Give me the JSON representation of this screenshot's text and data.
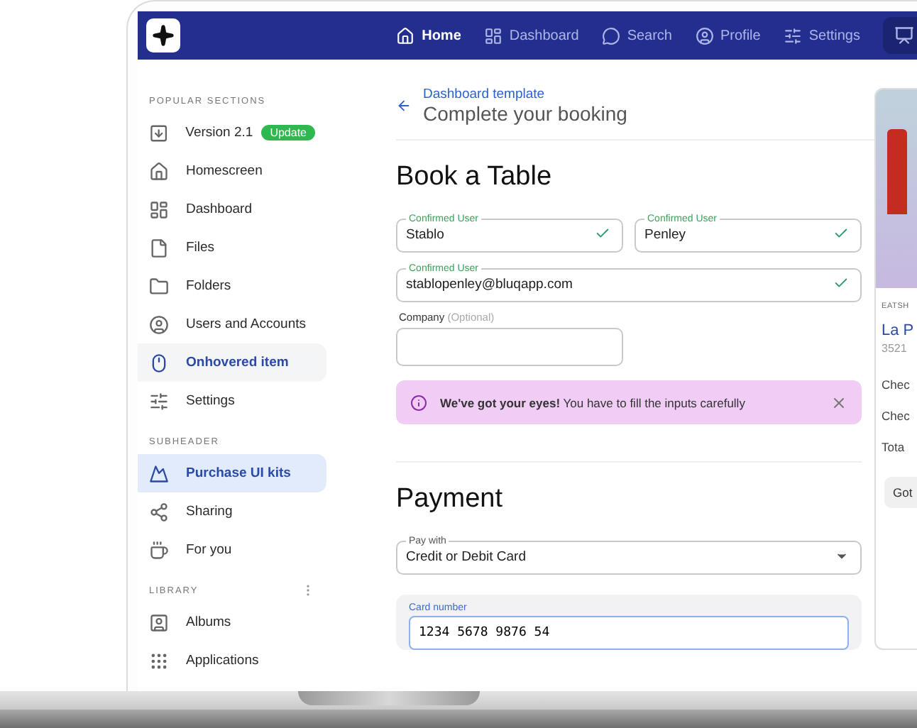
{
  "nav": {
    "items": [
      {
        "label": "Home",
        "selected": true
      },
      {
        "label": "Dashboard",
        "selected": false
      },
      {
        "label": "Search",
        "selected": false
      },
      {
        "label": "Profile",
        "selected": false
      },
      {
        "label": "Settings",
        "selected": false
      }
    ]
  },
  "sidebar": {
    "sections": [
      {
        "header": "POPULAR SECTIONS",
        "menu": false,
        "items": [
          {
            "label": "Version 2.1",
            "badge": "Update",
            "hovered": false,
            "selected": false
          },
          {
            "label": "Homescreen",
            "hovered": false,
            "selected": false
          },
          {
            "label": "Dashboard",
            "hovered": false,
            "selected": false
          },
          {
            "label": "Files",
            "hovered": false,
            "selected": false
          },
          {
            "label": "Folders",
            "hovered": false,
            "selected": false
          },
          {
            "label": "Users and Accounts",
            "hovered": false,
            "selected": false
          },
          {
            "label": "Onhovered item",
            "hovered": true,
            "selected": false
          },
          {
            "label": "Settings",
            "hovered": false,
            "selected": false
          }
        ]
      },
      {
        "header": "SUBHEADER",
        "menu": false,
        "items": [
          {
            "label": "Purchase UI kits",
            "hovered": false,
            "selected": true
          },
          {
            "label": "Sharing",
            "hovered": false,
            "selected": false
          },
          {
            "label": "For you",
            "hovered": false,
            "selected": false
          }
        ]
      },
      {
        "header": "LIBRARY",
        "menu": true,
        "items": [
          {
            "label": "Albums",
            "hovered": false,
            "selected": false
          },
          {
            "label": "Applications",
            "hovered": false,
            "selected": false
          }
        ]
      }
    ]
  },
  "header": {
    "breadcrumb": "Dashboard template",
    "title": "Complete your booking"
  },
  "booking": {
    "heading": "Book a Table",
    "fields": [
      {
        "label": "Confirmed User",
        "value": "Stablo",
        "valid": true,
        "wide": false
      },
      {
        "label": "Confirmed User",
        "value": "Penley",
        "valid": true,
        "wide": false
      },
      {
        "label": "Confirmed User",
        "value": "stablopenley@bluqapp.com",
        "valid": true,
        "wide": true
      }
    ],
    "company": {
      "label": "Company",
      "hint": "(Optional)"
    },
    "alert": {
      "text": "**We've got your eyes!** You have to fill the inputs carefully"
    }
  },
  "payment": {
    "heading": "Payment",
    "select": {
      "label": "Pay with",
      "value": "Credit or Debit Card"
    },
    "card": {
      "label": "Card number",
      "value": "1234 5678 9876 54",
      "focused": true
    }
  },
  "side_card": {
    "category": "EATSH",
    "name": "La P",
    "address": "3521",
    "rows": [
      "Chec",
      "Chec",
      "Tota"
    ],
    "button": "Got"
  }
}
